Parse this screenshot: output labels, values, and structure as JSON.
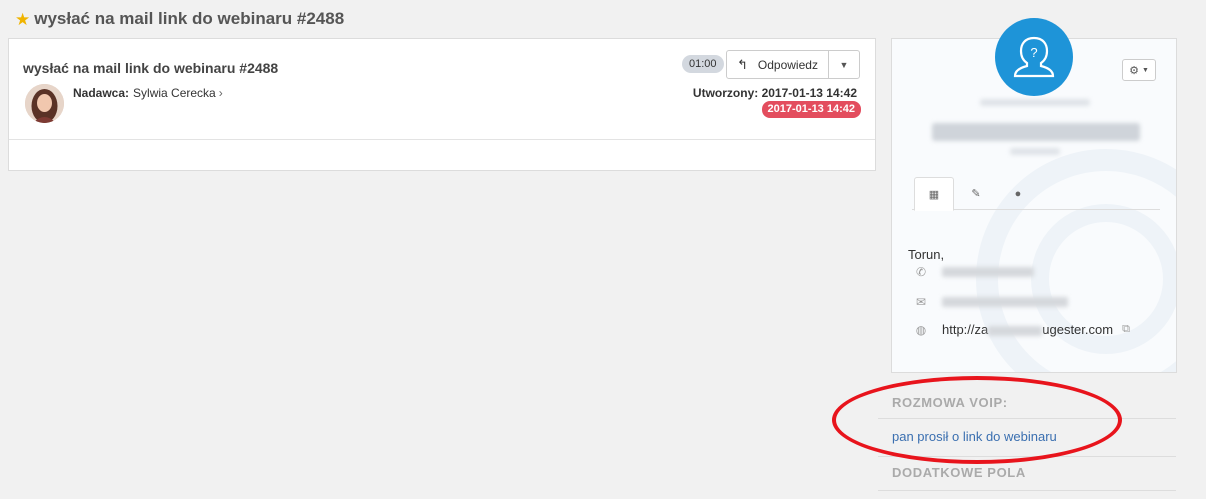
{
  "page": {
    "title": "wysłać na mail link do webinaru #2488"
  },
  "ticket": {
    "subject": "wysłać na mail link do webinaru #2488",
    "sender_label": "Nadawca:",
    "sender_name": "Sylwia Cerecka",
    "timer": "01:00",
    "reply_label": "Odpowiedz",
    "created_label": "Utworzony:",
    "created_value": "2017-01-13 14:42",
    "due_badge": "2017-01-13 14:42"
  },
  "contact": {
    "city": "Torun,",
    "website_prefix": "http://za",
    "website_suffix": "ugester.com",
    "tabs": [
      "company-tab",
      "edit-tab",
      "person-tab"
    ]
  },
  "sections": {
    "voip_title": "ROZMOWA VOIP:",
    "voip_link": "pan prosił o link do webinaru",
    "extra_title": "DODATKOWE POLA"
  },
  "colors": {
    "accent_blue": "#1e94d8",
    "badge_red": "#e34d5e",
    "highlight_red": "#e8141c",
    "link_blue": "#3a6fb0",
    "star": "#f0b400"
  }
}
